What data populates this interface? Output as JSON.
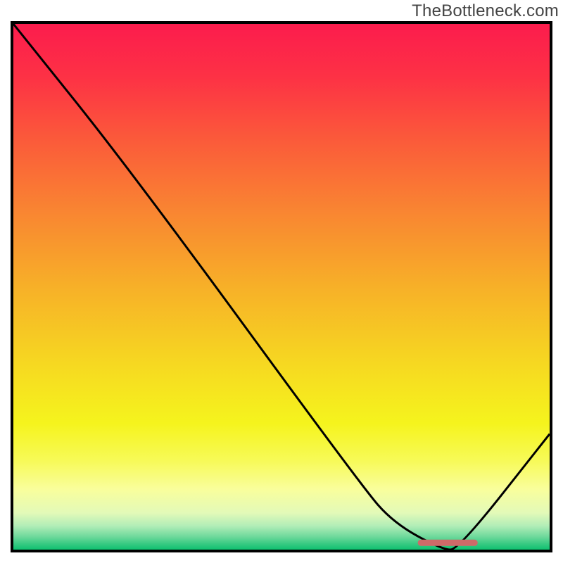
{
  "watermark": "TheBottleneck.com",
  "chart_data": {
    "type": "line",
    "title": "",
    "xlabel": "",
    "ylabel": "",
    "xlim": [
      0,
      100
    ],
    "ylim": [
      0,
      100
    ],
    "grid": false,
    "series": [
      {
        "name": "curve",
        "x": [
          0,
          22,
          65,
          71,
          80,
          83,
          100
        ],
        "values": [
          100,
          72,
          12,
          5,
          0,
          0,
          22
        ],
        "stroke": "#000000"
      }
    ],
    "segment": {
      "x_start": 76,
      "x_end": 86,
      "y": 1.3,
      "stroke": "#ce6a69"
    },
    "background_gradient_stops": [
      {
        "offset": 0.0,
        "color": "#fc1c4d"
      },
      {
        "offset": 0.1,
        "color": "#fd3145"
      },
      {
        "offset": 0.22,
        "color": "#fb5a3a"
      },
      {
        "offset": 0.35,
        "color": "#f98332"
      },
      {
        "offset": 0.5,
        "color": "#f7b028"
      },
      {
        "offset": 0.65,
        "color": "#f6d921"
      },
      {
        "offset": 0.76,
        "color": "#f5f41d"
      },
      {
        "offset": 0.83,
        "color": "#f7fa57"
      },
      {
        "offset": 0.885,
        "color": "#f9fe9c"
      },
      {
        "offset": 0.93,
        "color": "#e3fab8"
      },
      {
        "offset": 0.955,
        "color": "#b1edb7"
      },
      {
        "offset": 0.975,
        "color": "#6fd99c"
      },
      {
        "offset": 0.99,
        "color": "#34c980"
      },
      {
        "offset": 1.0,
        "color": "#0fc070"
      }
    ]
  }
}
